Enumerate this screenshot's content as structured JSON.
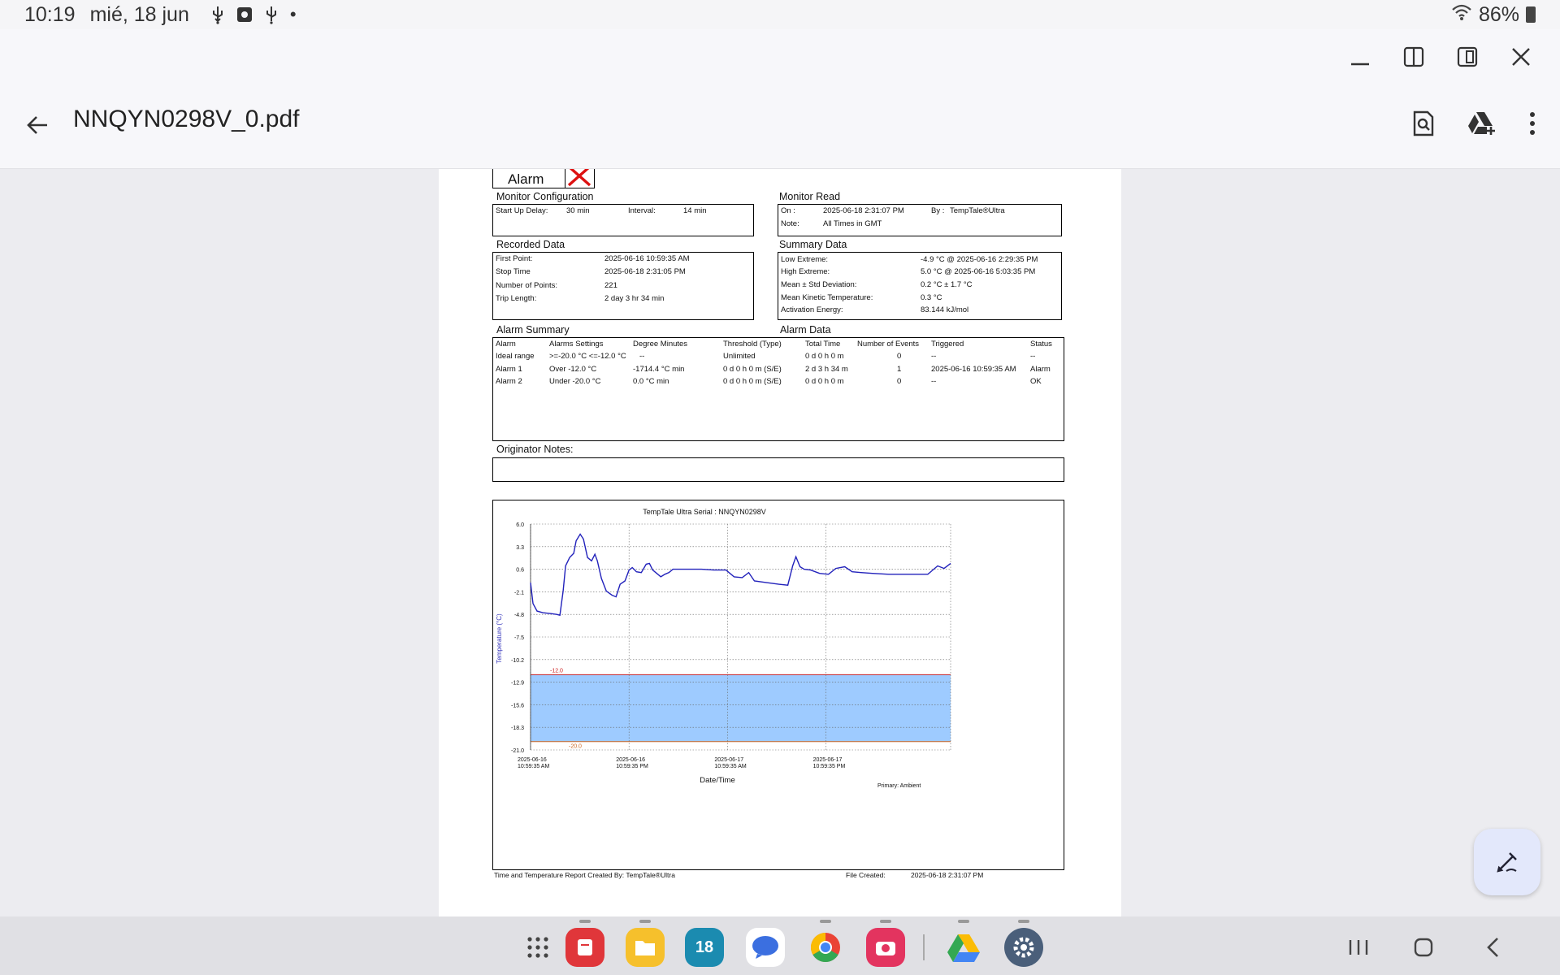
{
  "status_bar": {
    "time": "10:19",
    "date": "mié, 18 jun",
    "battery": "86%"
  },
  "app_bar": {
    "title": "NNQYN0298V_0.pdf"
  },
  "report": {
    "alarm_label": "Alarm",
    "monitor_config": {
      "heading": "Monitor Configuration",
      "startup_label": "Start Up Delay:",
      "startup_value": "30 min",
      "interval_label": "Interval:",
      "interval_value": "14 min"
    },
    "monitor_read": {
      "heading": "Monitor Read",
      "on_label": "On :",
      "on_value": "2025-06-18  2:31:07 PM",
      "by_label": "By :",
      "by_value": "TempTale®Ultra",
      "note_label": "Note:",
      "note_value": "All Times in GMT"
    },
    "recorded_data": {
      "heading": "Recorded Data",
      "rows": [
        {
          "label": "First Point:",
          "value": "2025-06-16 10:59:35 AM"
        },
        {
          "label": "Stop Time",
          "value": "2025-06-18  2:31:05 PM"
        },
        {
          "label": "Number of Points:",
          "value": "221"
        },
        {
          "label": "Trip Length:",
          "value": "2 day 3 hr 34 min"
        }
      ]
    },
    "summary_data": {
      "heading": "Summary Data",
      "rows": [
        {
          "label": "Low Extreme:",
          "value": "-4.9 °C @ 2025-06-16  2:29:35 PM"
        },
        {
          "label": "High Extreme:",
          "value": "5.0 °C @ 2025-06-16  5:03:35 PM"
        },
        {
          "label": "Mean ± Std Deviation:",
          "value": "0.2 °C ± 1.7 °C"
        },
        {
          "label": "Mean Kinetic Temperature:",
          "value": "0.3 °C"
        },
        {
          "label": "Activation Energy:",
          "value": "83.144 kJ/mol"
        }
      ]
    },
    "alarm_summary_heading": "Alarm Summary",
    "alarm_data_heading": "Alarm Data",
    "alarm_table": {
      "headers": [
        "Alarm",
        "Alarms Settings",
        "Degree Minutes",
        "Threshold (Type)",
        "Total Time",
        "Number of Events",
        "Triggered",
        "Status"
      ],
      "rows": [
        [
          "Ideal range",
          ">=-20.0 °C <=-12.0 °C",
          "--",
          "Unlimited",
          "0 d 0 h 0 m",
          "0",
          "--",
          "--"
        ],
        [
          "Alarm 1",
          "Over -12.0 °C",
          "-1714.4 °C min",
          "0 d 0 h 0 m (S/E)",
          "2 d 3 h 34 m",
          "1",
          "2025-06-16 10:59:35 AM",
          "Alarm"
        ],
        [
          "Alarm 2",
          "Under -20.0 °C",
          "0.0 °C min",
          "0 d 0 h 0 m (S/E)",
          "0 d 0 h 0 m",
          "0",
          "--",
          "OK"
        ]
      ]
    },
    "originator_notes_label": "Originator Notes:",
    "footer": {
      "created_by": "Time and Temperature Report Created By:  TempTale®Ultra",
      "file_created_label": "File Created:",
      "file_created_value": "2025-06-18  2:31:07 PM"
    }
  },
  "chart_data": {
    "type": "line",
    "title": "TempTale Ultra  Serial : NNQYN0298V",
    "xlabel": "Date/Time",
    "ylabel": "Temperature     (°C)",
    "ylim": [
      -21.0,
      6.0
    ],
    "y_ticks": [
      "6.0",
      "3.3",
      "0.6",
      "-2.1",
      "-4.8",
      "-7.5",
      "-10.2",
      "-12.9",
      "-15.6",
      "-18.3",
      "-21.0"
    ],
    "x_ticks": [
      [
        "2025-06-16",
        "10:59:35 AM"
      ],
      [
        "2025-06-16",
        "10:59:35 PM"
      ],
      [
        "2025-06-17",
        "10:59:35 AM"
      ],
      [
        "2025-06-17",
        "10:59:35 PM"
      ]
    ],
    "xlim_hours": [
      0,
      51.6
    ],
    "band": {
      "low": -20.0,
      "high": -12.0,
      "low_label": "-20.0",
      "high_label": "-12.0",
      "color": "#9ecbff"
    },
    "series_label": "Primary: Ambient",
    "grid": true,
    "series": [
      {
        "color": "#2222bb",
        "points": [
          [
            0,
            -1.0
          ],
          [
            0.3,
            -3.5
          ],
          [
            0.8,
            -4.4
          ],
          [
            1.5,
            -4.6
          ],
          [
            2.5,
            -4.7
          ],
          [
            3.2,
            -4.8
          ],
          [
            3.6,
            -4.9
          ],
          [
            4.0,
            -2.0
          ],
          [
            4.3,
            1.0
          ],
          [
            4.8,
            2.0
          ],
          [
            5.3,
            2.5
          ],
          [
            5.6,
            4.0
          ],
          [
            6.1,
            4.8
          ],
          [
            6.5,
            4.2
          ],
          [
            7.0,
            2.0
          ],
          [
            7.5,
            1.6
          ],
          [
            7.9,
            2.4
          ],
          [
            8.2,
            1.6
          ],
          [
            8.7,
            -0.5
          ],
          [
            9.3,
            -2.0
          ],
          [
            10.0,
            -2.5
          ],
          [
            10.5,
            -2.7
          ],
          [
            11.0,
            -1.2
          ],
          [
            11.6,
            -0.8
          ],
          [
            12.1,
            0.5
          ],
          [
            12.5,
            0.8
          ],
          [
            13.0,
            0.3
          ],
          [
            13.6,
            0.2
          ],
          [
            14.2,
            1.2
          ],
          [
            14.6,
            1.3
          ],
          [
            15.0,
            0.5
          ],
          [
            15.5,
            0.1
          ],
          [
            16.0,
            -0.3
          ],
          [
            16.5,
            0.0
          ],
          [
            17.0,
            0.2
          ],
          [
            17.5,
            0.6
          ],
          [
            19.0,
            0.6
          ],
          [
            21.0,
            0.6
          ],
          [
            22.5,
            0.5
          ],
          [
            24.0,
            0.5
          ],
          [
            25.0,
            -0.3
          ],
          [
            26.0,
            -0.4
          ],
          [
            26.8,
            0.2
          ],
          [
            27.5,
            -0.8
          ],
          [
            29.0,
            -1.0
          ],
          [
            30.5,
            -1.2
          ],
          [
            31.6,
            -1.3
          ],
          [
            32.2,
            1.0
          ],
          [
            32.6,
            2.1
          ],
          [
            33.1,
            0.9
          ],
          [
            33.6,
            0.6
          ],
          [
            34.4,
            0.5
          ],
          [
            35.5,
            0.1
          ],
          [
            36.6,
            0.0
          ],
          [
            37.5,
            0.7
          ],
          [
            38.6,
            0.9
          ],
          [
            39.5,
            0.3
          ],
          [
            40.6,
            0.2
          ],
          [
            42.0,
            0.1
          ],
          [
            44.0,
            0.0
          ],
          [
            46.0,
            0.0
          ],
          [
            48.8,
            0.0
          ],
          [
            50.0,
            1.0
          ],
          [
            50.8,
            0.7
          ],
          [
            51.6,
            1.3
          ]
        ]
      }
    ]
  }
}
